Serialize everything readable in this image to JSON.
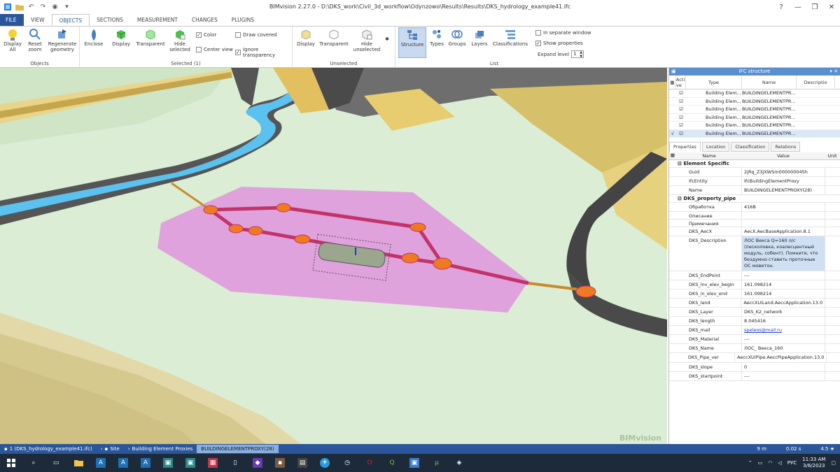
{
  "window": {
    "title": "BIMvision 2.27.0 - D:\\DKS_work\\Civil_3d_workflow\\Odynzowo\\Results\\Results\\DKS_hydrology_example41.ifc"
  },
  "tabs": [
    "FILE",
    "VIEW",
    "OBJECTS",
    "SECTIONS",
    "MEASUREMENT",
    "CHANGES",
    "PLUGINS"
  ],
  "active_tab": "OBJECTS",
  "ribbon": {
    "objects": {
      "label": "Objects",
      "display_all": "Display All",
      "reset_zoom": "Reset zoom",
      "regenerate": "Regenerate geometry"
    },
    "selected": {
      "label": "Selected (1)",
      "enclose": "Enclose",
      "display": "Display",
      "transparent": "Transparent",
      "hide_selected": "Hide selected",
      "color": "Color",
      "center_view": "Center view",
      "draw_covered": "Draw covered",
      "ignore_transparency": "Ignore transparency"
    },
    "unselected": {
      "label": "Unselected",
      "display": "Display",
      "transparent": "Transparent",
      "hide_unselected": "Hide unselected"
    },
    "list": {
      "label": "List",
      "structure": "Structure",
      "types": "Types",
      "groups": "Groups",
      "layers": "Layers",
      "classifications": "Classifications",
      "separate_window": "In separate window",
      "show_properties": "Show properties",
      "expand_level": "Expand level",
      "expand_value": "1"
    }
  },
  "viewport": {
    "watermark": "BIMvision"
  },
  "ifc_structure": {
    "title": "IFC structure",
    "headers": {
      "active": "Acti ve",
      "type": "Type",
      "name": "Name",
      "desc": "Descriptio"
    },
    "rows": [
      {
        "type": "Building Elem...",
        "name": "BUILDINGELEMENTPR..."
      },
      {
        "type": "Building Elem...",
        "name": "BUILDINGELEMENTPR..."
      },
      {
        "type": "Building Elem...",
        "name": "BUILDINGELEMENTPR..."
      },
      {
        "type": "Building Elem...",
        "name": "BUILDINGELEMENTPR..."
      },
      {
        "type": "Building Elem...",
        "name": "BUILDINGELEMENTPR..."
      },
      {
        "type": "Building Elem...",
        "name": "BUILDINGELEMENTPR..."
      }
    ]
  },
  "props_tabs": [
    "Properties",
    "Location",
    "Classification",
    "Relations"
  ],
  "props_headers": {
    "name": "Name",
    "value": "Value",
    "unit": "Unit"
  },
  "element_specific": {
    "title": "Element Specific",
    "rows": [
      {
        "name": "Guid",
        "value": "2jRq_Z3jXWSm000000045h"
      },
      {
        "name": "IfcEntity",
        "value": "IfcBuildingElementProxy"
      },
      {
        "name": "Name",
        "value": "BUILDINGELEMENTPROXY(28)"
      }
    ]
  },
  "dks_property_pipe": {
    "title": "DKS_property_pipe",
    "rows": [
      {
        "name": "Обработка",
        "value": "416В"
      },
      {
        "name": "Описание",
        "value": ""
      },
      {
        "name": "Примечания",
        "value": ""
      },
      {
        "name": "DKS_AecX",
        "value": "AecX.AecBaseApplication.8.1"
      },
      {
        "name": "DKS_Description",
        "value": "ЛОС Векса Q=160 л/с (песколовка, коалесцентный модуль, собент). Помните, что бездумно ставить проточные ОС моветон."
      },
      {
        "name": "DKS_EndPoint",
        "value": "---"
      },
      {
        "name": "DKS_inv_elev_begin",
        "value": "161.098214"
      },
      {
        "name": "DKS_in_elev_end",
        "value": "161.098214"
      },
      {
        "name": "DKS_land",
        "value": "AeccXUiLand.AeccApplication.13.0"
      },
      {
        "name": "DKS_Layer",
        "value": "DKS_K2_network"
      },
      {
        "name": "DKS_length",
        "value": "8.045416"
      },
      {
        "name": "DKS_mail",
        "value": "speleos@mail.ru"
      },
      {
        "name": "DKS_Material",
        "value": "---"
      },
      {
        "name": "DKS_Name",
        "value": "ЛОС_ Векса_160"
      },
      {
        "name": "DKS_Pipe_ver",
        "value": "AeccXUiPipe.AeccPipeApplication.13.0"
      },
      {
        "name": "DKS_slope",
        "value": "0"
      },
      {
        "name": "DKS_startpoint",
        "value": "---"
      }
    ]
  },
  "statusbar": {
    "breadcrumbs": [
      "1 (DKS_hydrology_example41.ifc)",
      "Site",
      "Building Element Proxies",
      "BUILDINGELEMENTPROXY(28)"
    ],
    "scale": "9 m",
    "time": "0.02 s",
    "zoom": "4.5 ★"
  },
  "taskbar": {
    "lang": "РУС",
    "time": "11:33 AM",
    "date": "3/6/2023"
  }
}
